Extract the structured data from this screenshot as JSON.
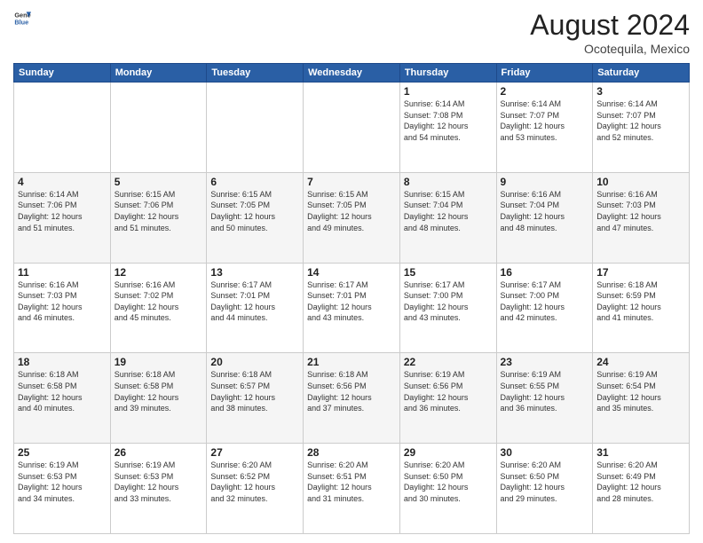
{
  "logo": {
    "line1": "General",
    "line2": "Blue"
  },
  "title": "August 2024",
  "subtitle": "Ocotequila, Mexico",
  "days_header": [
    "Sunday",
    "Monday",
    "Tuesday",
    "Wednesday",
    "Thursday",
    "Friday",
    "Saturday"
  ],
  "weeks": [
    [
      {
        "day": "",
        "info": ""
      },
      {
        "day": "",
        "info": ""
      },
      {
        "day": "",
        "info": ""
      },
      {
        "day": "",
        "info": ""
      },
      {
        "day": "1",
        "info": "Sunrise: 6:14 AM\nSunset: 7:08 PM\nDaylight: 12 hours\nand 54 minutes."
      },
      {
        "day": "2",
        "info": "Sunrise: 6:14 AM\nSunset: 7:07 PM\nDaylight: 12 hours\nand 53 minutes."
      },
      {
        "day": "3",
        "info": "Sunrise: 6:14 AM\nSunset: 7:07 PM\nDaylight: 12 hours\nand 52 minutes."
      }
    ],
    [
      {
        "day": "4",
        "info": "Sunrise: 6:14 AM\nSunset: 7:06 PM\nDaylight: 12 hours\nand 51 minutes."
      },
      {
        "day": "5",
        "info": "Sunrise: 6:15 AM\nSunset: 7:06 PM\nDaylight: 12 hours\nand 51 minutes."
      },
      {
        "day": "6",
        "info": "Sunrise: 6:15 AM\nSunset: 7:05 PM\nDaylight: 12 hours\nand 50 minutes."
      },
      {
        "day": "7",
        "info": "Sunrise: 6:15 AM\nSunset: 7:05 PM\nDaylight: 12 hours\nand 49 minutes."
      },
      {
        "day": "8",
        "info": "Sunrise: 6:15 AM\nSunset: 7:04 PM\nDaylight: 12 hours\nand 48 minutes."
      },
      {
        "day": "9",
        "info": "Sunrise: 6:16 AM\nSunset: 7:04 PM\nDaylight: 12 hours\nand 48 minutes."
      },
      {
        "day": "10",
        "info": "Sunrise: 6:16 AM\nSunset: 7:03 PM\nDaylight: 12 hours\nand 47 minutes."
      }
    ],
    [
      {
        "day": "11",
        "info": "Sunrise: 6:16 AM\nSunset: 7:03 PM\nDaylight: 12 hours\nand 46 minutes."
      },
      {
        "day": "12",
        "info": "Sunrise: 6:16 AM\nSunset: 7:02 PM\nDaylight: 12 hours\nand 45 minutes."
      },
      {
        "day": "13",
        "info": "Sunrise: 6:17 AM\nSunset: 7:01 PM\nDaylight: 12 hours\nand 44 minutes."
      },
      {
        "day": "14",
        "info": "Sunrise: 6:17 AM\nSunset: 7:01 PM\nDaylight: 12 hours\nand 43 minutes."
      },
      {
        "day": "15",
        "info": "Sunrise: 6:17 AM\nSunset: 7:00 PM\nDaylight: 12 hours\nand 43 minutes."
      },
      {
        "day": "16",
        "info": "Sunrise: 6:17 AM\nSunset: 7:00 PM\nDaylight: 12 hours\nand 42 minutes."
      },
      {
        "day": "17",
        "info": "Sunrise: 6:18 AM\nSunset: 6:59 PM\nDaylight: 12 hours\nand 41 minutes."
      }
    ],
    [
      {
        "day": "18",
        "info": "Sunrise: 6:18 AM\nSunset: 6:58 PM\nDaylight: 12 hours\nand 40 minutes."
      },
      {
        "day": "19",
        "info": "Sunrise: 6:18 AM\nSunset: 6:58 PM\nDaylight: 12 hours\nand 39 minutes."
      },
      {
        "day": "20",
        "info": "Sunrise: 6:18 AM\nSunset: 6:57 PM\nDaylight: 12 hours\nand 38 minutes."
      },
      {
        "day": "21",
        "info": "Sunrise: 6:18 AM\nSunset: 6:56 PM\nDaylight: 12 hours\nand 37 minutes."
      },
      {
        "day": "22",
        "info": "Sunrise: 6:19 AM\nSunset: 6:56 PM\nDaylight: 12 hours\nand 36 minutes."
      },
      {
        "day": "23",
        "info": "Sunrise: 6:19 AM\nSunset: 6:55 PM\nDaylight: 12 hours\nand 36 minutes."
      },
      {
        "day": "24",
        "info": "Sunrise: 6:19 AM\nSunset: 6:54 PM\nDaylight: 12 hours\nand 35 minutes."
      }
    ],
    [
      {
        "day": "25",
        "info": "Sunrise: 6:19 AM\nSunset: 6:53 PM\nDaylight: 12 hours\nand 34 minutes."
      },
      {
        "day": "26",
        "info": "Sunrise: 6:19 AM\nSunset: 6:53 PM\nDaylight: 12 hours\nand 33 minutes."
      },
      {
        "day": "27",
        "info": "Sunrise: 6:20 AM\nSunset: 6:52 PM\nDaylight: 12 hours\nand 32 minutes."
      },
      {
        "day": "28",
        "info": "Sunrise: 6:20 AM\nSunset: 6:51 PM\nDaylight: 12 hours\nand 31 minutes."
      },
      {
        "day": "29",
        "info": "Sunrise: 6:20 AM\nSunset: 6:50 PM\nDaylight: 12 hours\nand 30 minutes."
      },
      {
        "day": "30",
        "info": "Sunrise: 6:20 AM\nSunset: 6:50 PM\nDaylight: 12 hours\nand 29 minutes."
      },
      {
        "day": "31",
        "info": "Sunrise: 6:20 AM\nSunset: 6:49 PM\nDaylight: 12 hours\nand 28 minutes."
      }
    ]
  ]
}
